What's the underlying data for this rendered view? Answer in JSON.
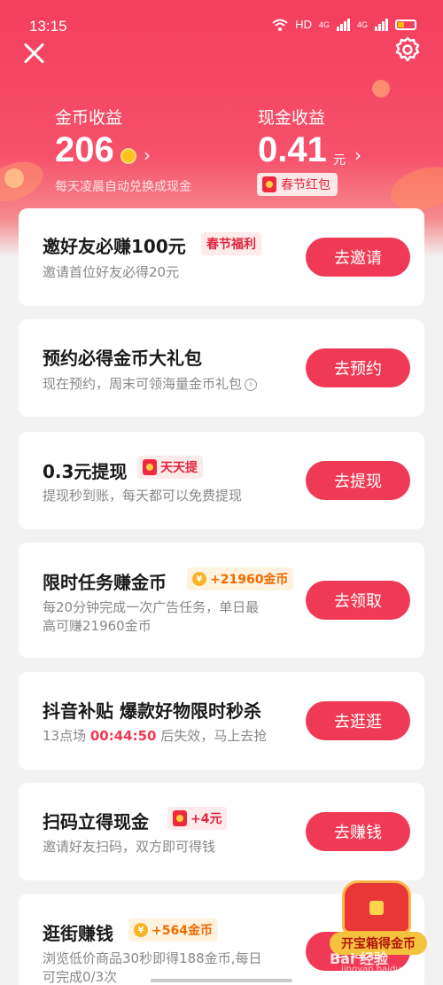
{
  "status_bar": {
    "time": "13:15",
    "hd": "HD",
    "net1": "4G",
    "net2": "4G"
  },
  "earnings": {
    "coin_label": "金币收益",
    "coin_value": "206",
    "coin_sub": "每天凌晨自动兑换成现金",
    "cash_label": "现金收益",
    "cash_value": "0.41",
    "cash_unit": "元",
    "cash_tag": "春节红包"
  },
  "tasks": [
    {
      "title": "邀好友必赚100元",
      "tag": "春节福利",
      "desc": "邀请首位好友必得20元",
      "button": "去邀请"
    },
    {
      "title": "预约必得金币大礼包",
      "desc": "现在预约，周末可领海量金币礼包",
      "button": "去预约"
    },
    {
      "title": "0.3元提现",
      "tag": "天天提",
      "desc": "提现秒到账，每天都可以免费提现",
      "button": "去提现"
    },
    {
      "title": "限时任务赚金币",
      "tag": "+21960金币",
      "desc_line1": "每20分钟完成一次广告任务，单日最",
      "desc_line2": "高可赚21960金币",
      "button": "去领取"
    },
    {
      "title": "抖音补贴 爆款好物限时秒杀",
      "desc_prefix": "13点场",
      "countdown": "00:44:50",
      "desc_suffix": "后失效，马上去抢",
      "button": "去逛逛"
    },
    {
      "title": "扫码立得现金",
      "tag": "+4元",
      "desc": "邀请好友扫码，双方即可得钱",
      "button": "去赚钱"
    },
    {
      "title": "逛街赚钱",
      "tag": "+564金币",
      "desc_line1": "浏览低价商品30秒即得188金币,每日",
      "desc_line2": "可完成0/3次",
      "button": "去逛逛"
    }
  ],
  "treasure": {
    "label": "开宝箱得金币"
  },
  "watermark": {
    "text": "Bai 经验",
    "url": "jingyan.baidu.com"
  },
  "colors": {
    "accent": "#f03a55",
    "header_top": "#f43e5d",
    "coin": "#ffc21a"
  }
}
